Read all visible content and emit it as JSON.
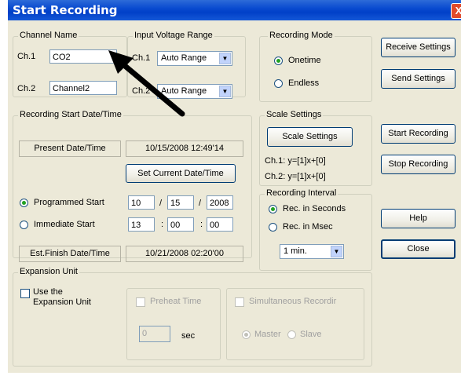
{
  "window": {
    "title": "Start Recording",
    "close_glyph": "X"
  },
  "channel_name": {
    "group_title": "Channel Name",
    "ch1_label": "Ch.1",
    "ch1_value": "CO2",
    "ch2_label": "Ch.2",
    "ch2_value": "Channel2"
  },
  "input_voltage": {
    "group_title": "Input Voltage Range",
    "ch1_label": "Ch.1",
    "ch1_selected": "Auto Range",
    "ch2_label": "Ch.2",
    "ch2_selected": "Auto Range"
  },
  "recording_mode": {
    "group_title": "Recording Mode",
    "options": [
      "Onetime",
      "Endless"
    ],
    "selected": "Onetime"
  },
  "start_datetime": {
    "group_title": "Recording Start Date/Time",
    "present_label": "Present Date/Time",
    "present_value": "10/15/2008 12:49'14",
    "set_current_button": "Set Current Date/Time",
    "programmed_label": "Programmed Start",
    "immediate_label": "Immediate Start",
    "selected": "Programmed Start",
    "month": "10",
    "day": "15",
    "year": "2008",
    "date_sep": "/",
    "hour": "13",
    "minute": "00",
    "second": "00",
    "time_sep": ":",
    "finish_label": "Est.Finish Date/Time",
    "finish_value": "10/21/2008 02:20'00"
  },
  "scale_settings": {
    "group_title": "Scale Settings",
    "button": "Scale Settings",
    "ch1_formula": "Ch.1: y=[1]x+[0]",
    "ch2_formula": "Ch.2: y=[1]x+[0]"
  },
  "recording_interval": {
    "group_title": "Recording Interval",
    "options": [
      "Rec. in Seconds",
      "Rec. in Msec"
    ],
    "selected": "Rec. in Seconds",
    "interval_selected": "1 min."
  },
  "expansion_unit": {
    "group_title": "Expansion Unit",
    "use_label_line1": "Use the",
    "use_label_line2": "Expansion Unit",
    "use_checked": false,
    "preheat_label": "Preheat Time",
    "preheat_value": "0",
    "preheat_unit": "sec",
    "simultaneous_label": "Simultaneous Recordir",
    "master_label": "Master",
    "slave_label": "Slave",
    "master_selected": true
  },
  "side_buttons": {
    "receive": "Receive Settings",
    "send": "Send Settings",
    "start": "Start Recording",
    "stop": "Stop Recording",
    "help": "Help",
    "close": "Close"
  },
  "dropdown_arrow": "▼",
  "colors": {
    "titlebar": "#0a4bd0",
    "dialog_bg": "#ECE9D8",
    "close_red": "#e04a2b",
    "radio_green": "#21a121",
    "annotation_arrow": "#000000"
  }
}
